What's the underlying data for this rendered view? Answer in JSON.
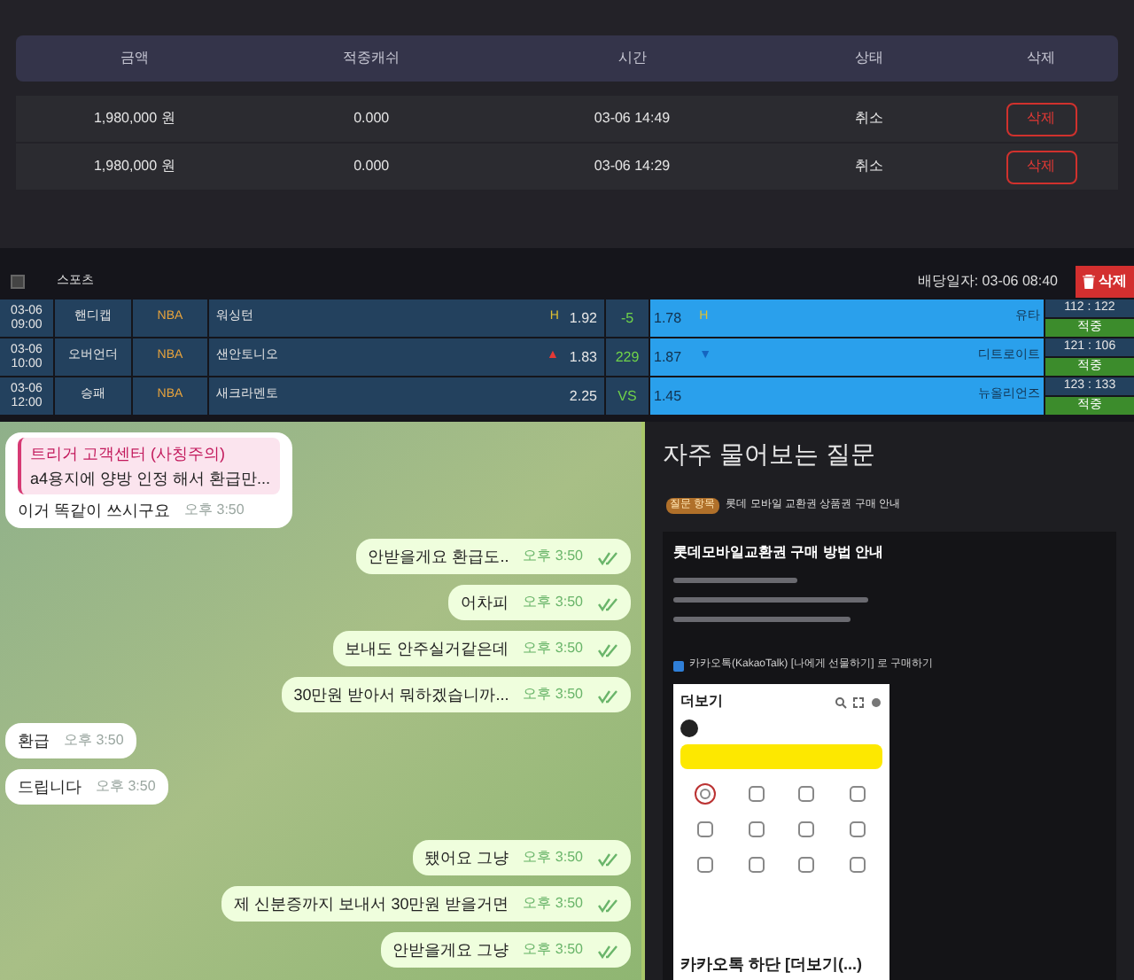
{
  "history": {
    "columns": [
      "금액",
      "적중캐쉬",
      "시간",
      "상태",
      "삭제"
    ],
    "rows": [
      {
        "amount": "1,980,000 원",
        "value": "0.000",
        "time": "03-06 14:49",
        "status": "취소",
        "action": "삭제"
      },
      {
        "amount": "1,980,000 원",
        "value": "0.000",
        "time": "03-06 14:29",
        "status": "취소",
        "action": "삭제"
      }
    ]
  },
  "betslip": {
    "checked": false,
    "category": "스포츠",
    "bet_date": "배당일자: 03-06 08:40",
    "delete": "삭제",
    "rows": [
      {
        "date": "03-06",
        "time": "09:00",
        "type": "핸디캡",
        "league": "NBA",
        "home": "워싱턴",
        "home_mark": "H",
        "home_odds": "1.92",
        "middle": "-5",
        "away_odds": "1.78",
        "away_mark": "H",
        "away": "유타",
        "score": "112 : 122",
        "result": "적중"
      },
      {
        "date": "03-06",
        "time": "10:00",
        "type": "오버언더",
        "league": "NBA",
        "home": "샌안토니오",
        "home_mark": "▲",
        "home_odds": "1.83",
        "middle": "229",
        "away_odds": "1.87",
        "away_mark": "▼",
        "away": "디트로이트",
        "score": "121 : 106",
        "result": "적중"
      },
      {
        "date": "03-06",
        "time": "12:00",
        "type": "승패",
        "league": "NBA",
        "home": "새크라멘토",
        "home_odds": "2.25",
        "middle": "VS",
        "away_odds": "1.45",
        "away": "뉴올리언즈",
        "score": "123 : 133",
        "result": "적중"
      }
    ]
  },
  "chat": [
    {
      "kind": "in",
      "reply_title": "트리거 고객센터 (사칭주의)",
      "reply_text": "a4용지에  양방 인정 해서 환급만...",
      "text": "이거 똑같이 쓰시구요",
      "time": "오후 3:50"
    },
    {
      "kind": "out",
      "text": "안받을게요 환급도..",
      "time": "오후 3:50"
    },
    {
      "kind": "out",
      "text": "어차피",
      "time": "오후 3:50"
    },
    {
      "kind": "out",
      "text": "보내도 안주실거같은데",
      "time": "오후 3:50"
    },
    {
      "kind": "out",
      "text": "30만원 받아서 뭐하겠습니까...",
      "time": "오후 3:50"
    },
    {
      "kind": "in",
      "text": "환급",
      "time": "오후 3:50"
    },
    {
      "kind": "in",
      "text": "드립니다",
      "time": "오후 3:50"
    },
    {
      "kind": "out",
      "text": "됐어요 그냥",
      "time": "오후 3:50"
    },
    {
      "kind": "out",
      "text": "제 신분증까지 보내서 30만원 받을거면",
      "time": "오후 3:50"
    },
    {
      "kind": "out",
      "text": "안받을게요 그냥",
      "time": "오후 3:50"
    }
  ],
  "faq": {
    "title": "자주 물어보는 질문",
    "tag": "질문 항목",
    "topic": "롯데 모바일 교환권 상품권 구매 안내",
    "card_title": "롯데모바일교환권 구매 방법 안내",
    "option": "카카오톡(KakaoTalk) [나에게 선물하기] 로 구매하기",
    "phone_title": "더보기",
    "caption": "카카오톡 하단 [더보기(...)"
  }
}
